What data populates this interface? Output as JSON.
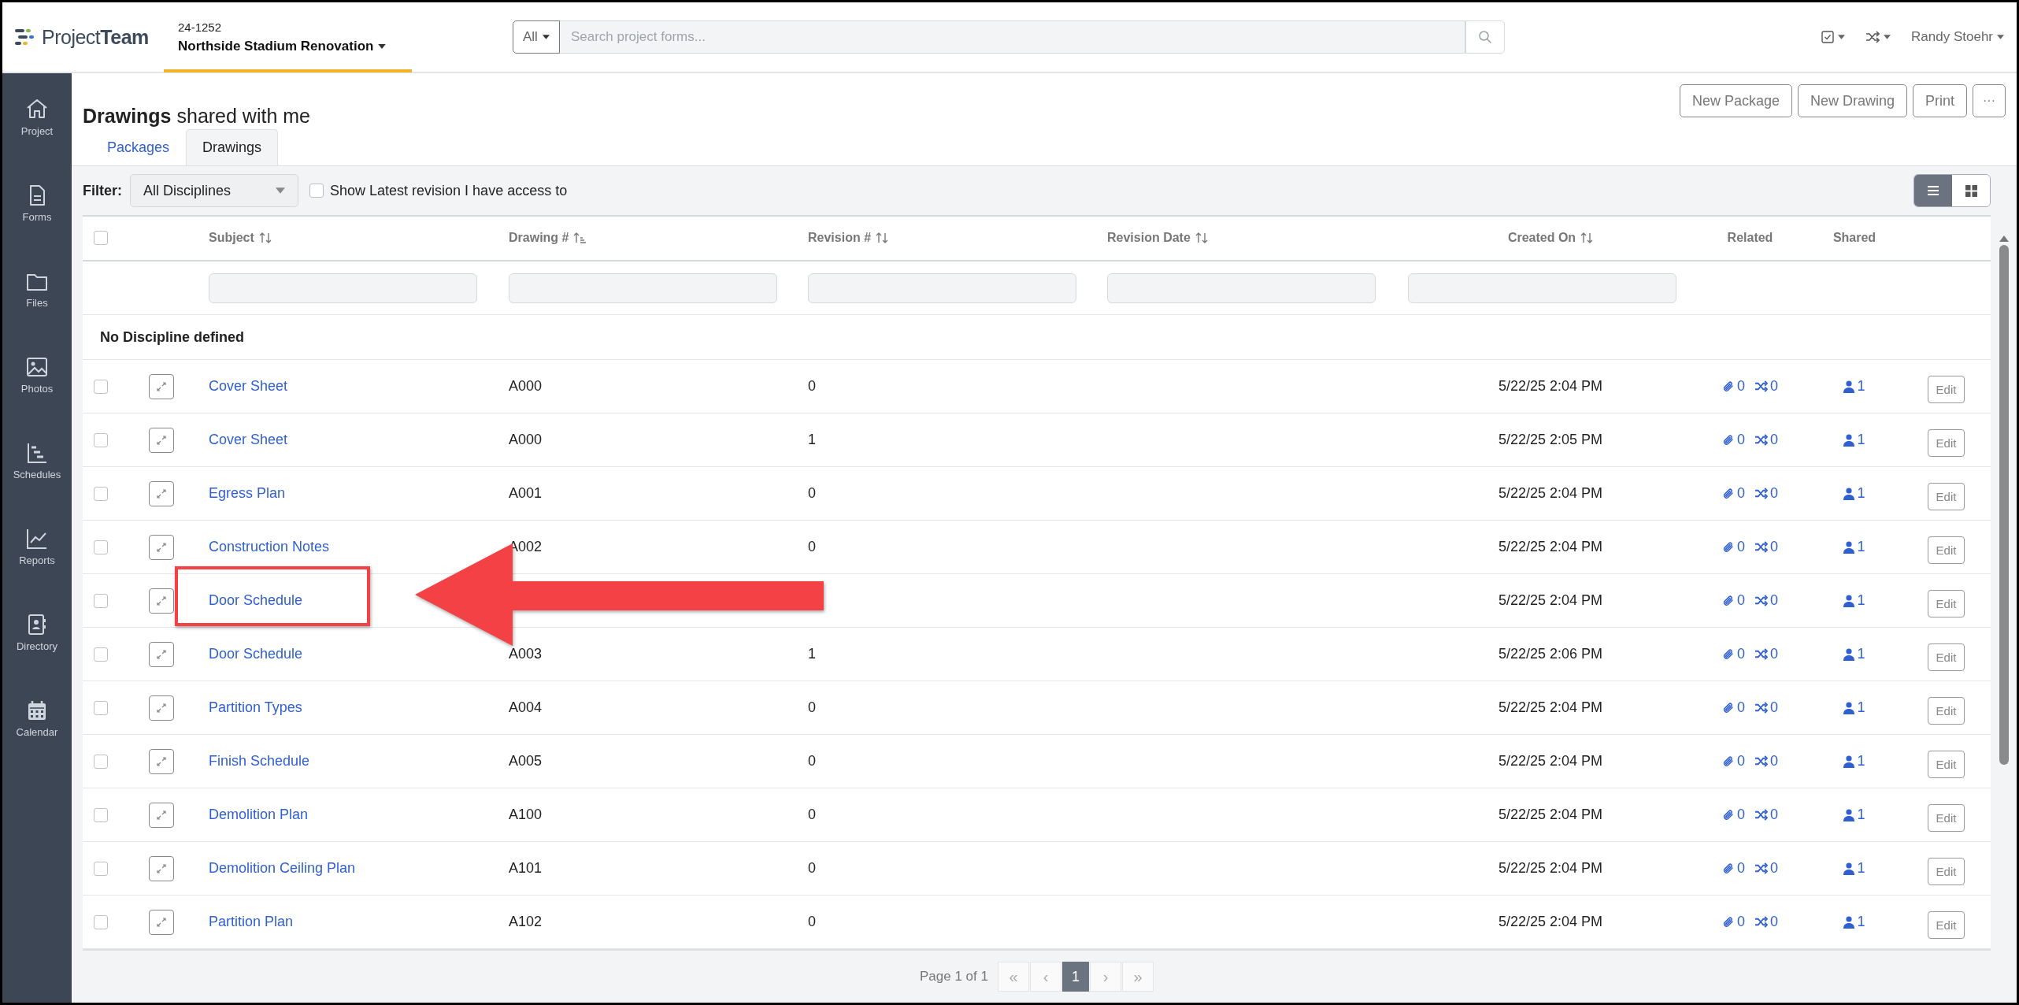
{
  "app": {
    "logo": "Project**Team**"
  },
  "project": {
    "number": "24-1252",
    "name": "Northside Stadium Renovation"
  },
  "search": {
    "scope": "All",
    "placeholder": "Search project forms..."
  },
  "user": {
    "name": "Randy Stoehr"
  },
  "sidebar": {
    "items": [
      {
        "label": "Project",
        "kind": "home"
      },
      {
        "label": "Forms",
        "kind": "file"
      },
      {
        "label": "Files",
        "kind": "folder"
      },
      {
        "label": "Photos",
        "kind": "image"
      },
      {
        "label": "Schedules",
        "kind": "gantt"
      },
      {
        "label": "Reports",
        "kind": "chart"
      },
      {
        "label": "Directory",
        "kind": "contacts"
      },
      {
        "label": "Calendar",
        "kind": "calendar"
      }
    ]
  },
  "page": {
    "title": "**Drawings** shared with me",
    "actions": [
      "New Package",
      "New Drawing",
      "Print",
      "···"
    ]
  },
  "tabs": [
    {
      "label": "Packages",
      "selected": false
    },
    {
      "label": "Drawings",
      "selected": true
    }
  ],
  "filter": {
    "label": "Filter:",
    "discipline": "All Disciplines",
    "latest_only": {
      "label": "Show Latest revision I have access to",
      "checked": false
    }
  },
  "view_modes": [
    {
      "kind": "list",
      "selected": true
    },
    {
      "kind": "grid",
      "selected": false
    }
  ],
  "table": {
    "select_all": {
      "checked": false
    },
    "columns": [
      {
        "label": "Subject",
        "sortable": true,
        "ascending": false,
        "filterable": true
      },
      {
        "label": "Drawing #",
        "sortable": true,
        "ascending": true,
        "filterable": true
      },
      {
        "label": "Revision #",
        "sortable": true,
        "ascending": false,
        "filterable": true
      },
      {
        "label": "Revision Date",
        "sortable": true,
        "ascending": false,
        "filterable": true
      },
      {
        "label": "Created On",
        "sortable": true,
        "ascending": false,
        "filterable": true
      },
      {
        "label": "Related",
        "sortable": false,
        "ascending": false,
        "filterable": false
      },
      {
        "label": "Shared",
        "sortable": false,
        "ascending": false,
        "filterable": false
      }
    ],
    "group": "No Discipline defined",
    "rows": [
      {
        "subject": "Cover Sheet",
        "drawing": "A000",
        "revision": "0",
        "created": "5/22/25 2:04 PM",
        "attachments": "0",
        "links": "0",
        "shared": "1",
        "action": "Edit",
        "checked": false,
        "highlighted": false
      },
      {
        "subject": "Cover Sheet",
        "drawing": "A000",
        "revision": "1",
        "created": "5/22/25 2:05 PM",
        "attachments": "0",
        "links": "0",
        "shared": "1",
        "action": "Edit",
        "checked": false,
        "highlighted": false
      },
      {
        "subject": "Egress Plan",
        "drawing": "A001",
        "revision": "0",
        "created": "5/22/25 2:04 PM",
        "attachments": "0",
        "links": "0",
        "shared": "1",
        "action": "Edit",
        "checked": false,
        "highlighted": false
      },
      {
        "subject": "Construction Notes",
        "drawing": "A002",
        "revision": "0",
        "created": "5/22/25 2:04 PM",
        "attachments": "0",
        "links": "0",
        "shared": "1",
        "action": "Edit",
        "checked": false,
        "highlighted": false
      },
      {
        "subject": "Door Schedule",
        "created": "5/22/25 2:04 PM",
        "attachments": "0",
        "links": "0",
        "shared": "1",
        "action": "Edit",
        "checked": false,
        "highlighted": true
      },
      {
        "subject": "Door Schedule",
        "drawing": "A003",
        "revision": "1",
        "created": "5/22/25 2:06 PM",
        "attachments": "0",
        "links": "0",
        "shared": "1",
        "action": "Edit",
        "checked": false,
        "highlighted": false
      },
      {
        "subject": "Partition Types",
        "drawing": "A004",
        "revision": "0",
        "created": "5/22/25 2:04 PM",
        "attachments": "0",
        "links": "0",
        "shared": "1",
        "action": "Edit",
        "checked": false,
        "highlighted": false
      },
      {
        "subject": "Finish Schedule",
        "drawing": "A005",
        "revision": "0",
        "created": "5/22/25 2:04 PM",
        "attachments": "0",
        "links": "0",
        "shared": "1",
        "action": "Edit",
        "checked": false,
        "highlighted": false
      },
      {
        "subject": "Demolition Plan",
        "drawing": "A100",
        "revision": "0",
        "created": "5/22/25 2:04 PM",
        "attachments": "0",
        "links": "0",
        "shared": "1",
        "action": "Edit",
        "checked": false,
        "highlighted": false
      },
      {
        "subject": "Demolition Ceiling Plan",
        "drawing": "A101",
        "revision": "0",
        "created": "5/22/25 2:04 PM",
        "attachments": "0",
        "links": "0",
        "shared": "1",
        "action": "Edit",
        "checked": false,
        "highlighted": false
      },
      {
        "subject": "Partition Plan",
        "drawing": "A102",
        "revision": "0",
        "created": "5/22/25 2:04 PM",
        "attachments": "0",
        "links": "0",
        "shared": "1",
        "action": "Edit",
        "checked": false,
        "highlighted": false
      }
    ]
  },
  "pagination": {
    "summary": "Page 1 of 1",
    "first": "«",
    "prev": "‹",
    "next": "›",
    "last": "»",
    "pages": [
      {
        "label": "1",
        "selected": true
      }
    ]
  }
}
